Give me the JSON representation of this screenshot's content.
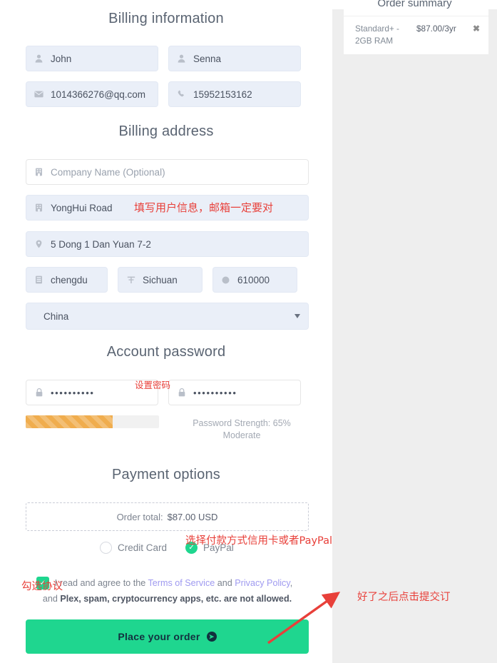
{
  "billing_information": {
    "title": "Billing information",
    "first_name": {
      "value": "John",
      "icon": "user-icon"
    },
    "last_name": {
      "value": "Senna",
      "icon": "user-icon"
    },
    "email": {
      "value": "1014366276@qq.com",
      "icon": "envelope-icon"
    },
    "phone": {
      "value": "15952153162",
      "icon": "phone-icon"
    }
  },
  "billing_address": {
    "title": "Billing address",
    "company": {
      "placeholder": "Company Name (Optional)",
      "value": "",
      "icon": "building-icon"
    },
    "street": {
      "value": "YongHui Road",
      "icon": "building-icon"
    },
    "address2": {
      "value": "5 Dong 1 Dan Yuan 7-2",
      "icon": "map-marker-icon"
    },
    "city": {
      "value": "chengdu",
      "icon": "building-icon"
    },
    "state": {
      "value": "Sichuan",
      "icon": "map-icon"
    },
    "zip": {
      "value": "610000",
      "icon": "circle-icon"
    },
    "country": {
      "value": "China",
      "icon": "chevron-down-icon"
    }
  },
  "account_password": {
    "title": "Account password",
    "password": {
      "value": "••••••••••",
      "icon": "lock-icon"
    },
    "confirm_password": {
      "value": "••••••••••",
      "icon": "lock-icon"
    },
    "strength_percent": 65,
    "strength_label": "Password Strength: 65%",
    "strength_rating": "Moderate",
    "strength_color": "#f0ad4e"
  },
  "payment_options": {
    "title": "Payment options",
    "order_total_label": "Order total:",
    "order_total_amount": "$87.00 USD",
    "methods": [
      {
        "label": "Credit Card",
        "selected": false
      },
      {
        "label": "PayPal",
        "selected": true
      }
    ],
    "accent_color": "#1fd68f"
  },
  "terms": {
    "checked": true,
    "prefix": "I read and agree to the ",
    "tos_link": "Terms of Service",
    "conjunction": " and ",
    "privacy_link": "Privacy Policy",
    "comma": ",",
    "line2_prefix": "and ",
    "line2_bold": "Plex, spam, cryptocurrency apps, etc. are not allowed.",
    "link_color": "#9f9af0"
  },
  "place_order": {
    "label": "Place your order",
    "icon": "arrow-right-circle-icon",
    "color": "#1fd68f"
  },
  "order_summary": {
    "title": "Order summary",
    "items": [
      {
        "name": "Standard+ - 2GB RAM",
        "price": "$87.00/3yr",
        "remove_icon": "close-icon"
      }
    ]
  },
  "annotations": {
    "color": "#e8403a",
    "user_info": "填写用户信息，邮箱一定要对",
    "set_password": "设置密码",
    "payment_method": "选择付款方式信用卡或者PayPal",
    "check_agreement": "勾选协议",
    "submit_order": "好了之后点击提交订"
  }
}
